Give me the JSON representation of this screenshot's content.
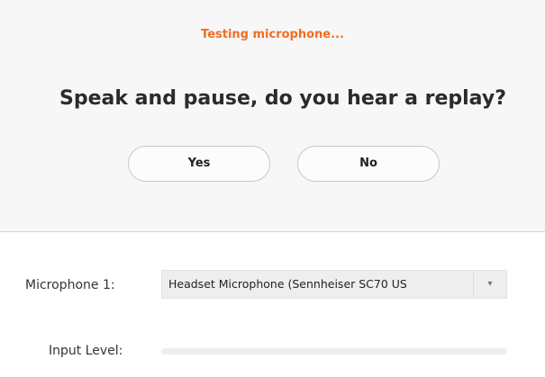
{
  "test": {
    "status": "Testing microphone...",
    "question": "Speak and pause, do you hear a replay?",
    "yes_label": "Yes",
    "no_label": "No"
  },
  "microphone": {
    "label": "Microphone 1:",
    "selected": "Headset Microphone (Sennheiser SC70 US",
    "dropdown_icon": "chevron-down-icon"
  },
  "input_level": {
    "label": "Input Level:",
    "level": 0
  },
  "colors": {
    "status": "#f26d21",
    "panel_background": "#f7f7f7",
    "text": "#2b2b2b"
  }
}
